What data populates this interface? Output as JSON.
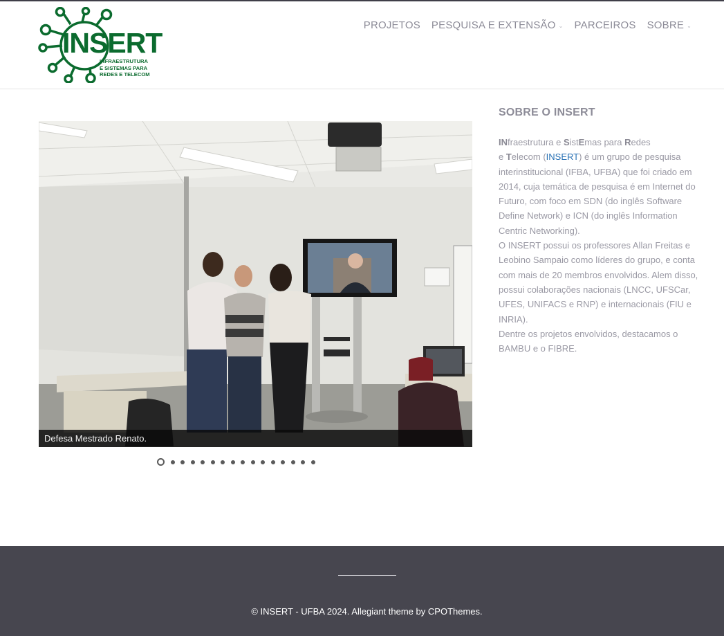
{
  "logo": {
    "title": "INSERT",
    "subtitle": "INFRAESTRUTURA\nE SISTEMAS PARA\nREDES E TELECOM",
    "color": "#0b6b2e"
  },
  "nav": {
    "items": [
      {
        "label": "PROJETOS"
      },
      {
        "label": "PESQUISA E EXTENSÃO",
        "dropdown_icon": "chevron-down-icon"
      },
      {
        "label": "PARCEIROS"
      },
      {
        "label": "SOBRE",
        "dropdown_icon": "chevron-down-icon"
      }
    ]
  },
  "slider": {
    "caption": "Defesa Mestrado Renato.",
    "slide_count": 16,
    "active_index": 0
  },
  "sidebar": {
    "title": "SOBRE O INSERT",
    "intro_parts": [
      "IN",
      "fraestrutura e ",
      "S",
      "ist",
      "E",
      "mas para ",
      "R",
      "edes",
      "e ",
      "T",
      "elecom (",
      "INSERT",
      ") é um grupo de pesquisa interinstitucional (IFBA, UFBA) que foi criado em 2014, cuja temática de pesquisa é em Internet do Futuro, com foco em SDN (do inglês Software Define Network) e ICN (do inglês Information Centric Networking)."
    ],
    "paragraph2": "O INSERT possui os professores Allan Freitas e Leobino Sampaio como líderes do grupo, e conta com mais de 20 membros envolvidos. Alem disso, possui colaborações nacionais (LNCC, UFSCar, UFES, UNIFACS e RNP) e internacionais (FIU e INRIA).",
    "paragraph3": "Dentre os projetos envolvidos, destacamos o BAMBU e o FIBRE.",
    "link_color": "#2a72b5"
  },
  "footer": {
    "copyright": "© INSERT - UFBA 2024.",
    "theme_label": "Allegiant theme",
    "by": "by",
    "author": "CPOThemes.",
    "background": "#47464f"
  }
}
